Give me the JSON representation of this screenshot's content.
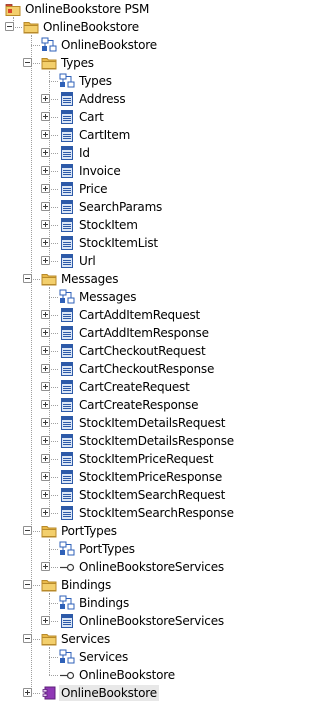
{
  "tree": [
    {
      "label": "OnlineBookstore PSM",
      "icon": "package-icon",
      "depth": 0,
      "expander": "none"
    },
    {
      "label": "OnlineBookstore",
      "icon": "folder-icon",
      "depth": 1,
      "expander": "minus"
    },
    {
      "label": "OnlineBookstore",
      "icon": "diagram-icon",
      "depth": 2,
      "expander": "none"
    },
    {
      "label": "Types",
      "icon": "folder-icon",
      "depth": 2,
      "expander": "minus"
    },
    {
      "label": "Types",
      "icon": "diagram-icon",
      "depth": 3,
      "expander": "none"
    },
    {
      "label": "Address",
      "icon": "class-icon",
      "depth": 3,
      "expander": "plus"
    },
    {
      "label": "Cart",
      "icon": "class-icon",
      "depth": 3,
      "expander": "plus"
    },
    {
      "label": "CartItem",
      "icon": "class-icon",
      "depth": 3,
      "expander": "plus"
    },
    {
      "label": "Id",
      "icon": "class-icon",
      "depth": 3,
      "expander": "plus"
    },
    {
      "label": "Invoice",
      "icon": "class-icon",
      "depth": 3,
      "expander": "plus"
    },
    {
      "label": "Price",
      "icon": "class-icon",
      "depth": 3,
      "expander": "plus"
    },
    {
      "label": "SearchParams",
      "icon": "class-icon",
      "depth": 3,
      "expander": "plus"
    },
    {
      "label": "StockItem",
      "icon": "class-icon",
      "depth": 3,
      "expander": "plus"
    },
    {
      "label": "StockItemList",
      "icon": "class-icon",
      "depth": 3,
      "expander": "plus"
    },
    {
      "label": "Url",
      "icon": "class-icon",
      "depth": 3,
      "expander": "plus"
    },
    {
      "label": "Messages",
      "icon": "folder-icon",
      "depth": 2,
      "expander": "minus"
    },
    {
      "label": "Messages",
      "icon": "diagram-icon",
      "depth": 3,
      "expander": "none"
    },
    {
      "label": "CartAddItemRequest",
      "icon": "class-icon",
      "depth": 3,
      "expander": "plus"
    },
    {
      "label": "CartAddItemResponse",
      "icon": "class-icon",
      "depth": 3,
      "expander": "plus"
    },
    {
      "label": "CartCheckoutRequest",
      "icon": "class-icon",
      "depth": 3,
      "expander": "plus"
    },
    {
      "label": "CartCheckoutResponse",
      "icon": "class-icon",
      "depth": 3,
      "expander": "plus"
    },
    {
      "label": "CartCreateRequest",
      "icon": "class-icon",
      "depth": 3,
      "expander": "plus"
    },
    {
      "label": "CartCreateResponse",
      "icon": "class-icon",
      "depth": 3,
      "expander": "plus"
    },
    {
      "label": "StockItemDetailsRequest",
      "icon": "class-icon",
      "depth": 3,
      "expander": "plus"
    },
    {
      "label": "StockItemDetailsResponse",
      "icon": "class-icon",
      "depth": 3,
      "expander": "plus"
    },
    {
      "label": "StockItemPriceRequest",
      "icon": "class-icon",
      "depth": 3,
      "expander": "plus"
    },
    {
      "label": "StockItemPriceResponse",
      "icon": "class-icon",
      "depth": 3,
      "expander": "plus"
    },
    {
      "label": "StockItemSearchRequest",
      "icon": "class-icon",
      "depth": 3,
      "expander": "plus"
    },
    {
      "label": "StockItemSearchResponse",
      "icon": "class-icon",
      "depth": 3,
      "expander": "plus"
    },
    {
      "label": "PortTypes",
      "icon": "folder-icon",
      "depth": 2,
      "expander": "minus"
    },
    {
      "label": "PortTypes",
      "icon": "diagram-icon",
      "depth": 3,
      "expander": "none"
    },
    {
      "label": "OnlineBookstoreServices",
      "icon": "interface-icon",
      "depth": 3,
      "expander": "plus"
    },
    {
      "label": "Bindings",
      "icon": "folder-icon",
      "depth": 2,
      "expander": "minus"
    },
    {
      "label": "Bindings",
      "icon": "diagram-icon",
      "depth": 3,
      "expander": "none"
    },
    {
      "label": "OnlineBookstoreServices",
      "icon": "class-icon",
      "depth": 3,
      "expander": "plus"
    },
    {
      "label": "Services",
      "icon": "folder-icon",
      "depth": 2,
      "expander": "minus"
    },
    {
      "label": "Services",
      "icon": "diagram-icon",
      "depth": 3,
      "expander": "none"
    },
    {
      "label": "OnlineBookstore",
      "icon": "interface-icon",
      "depth": 3,
      "expander": "none"
    },
    {
      "label": "OnlineBookstore",
      "icon": "component-icon",
      "depth": 2,
      "expander": "plus",
      "selected": true
    }
  ],
  "colors": {
    "folder_body": "#f3cf6c",
    "folder_tab": "#e9b94a",
    "folder_edge": "#b88a2a",
    "class_fill": "#dbe6f6",
    "class_edge": "#2d5aa8",
    "diagram_node": "#2f61b8",
    "package_red": "#d9442b",
    "component_purple": "#8f37b5",
    "connector": "#a0a0a0",
    "selection": "#e8e8e8"
  }
}
